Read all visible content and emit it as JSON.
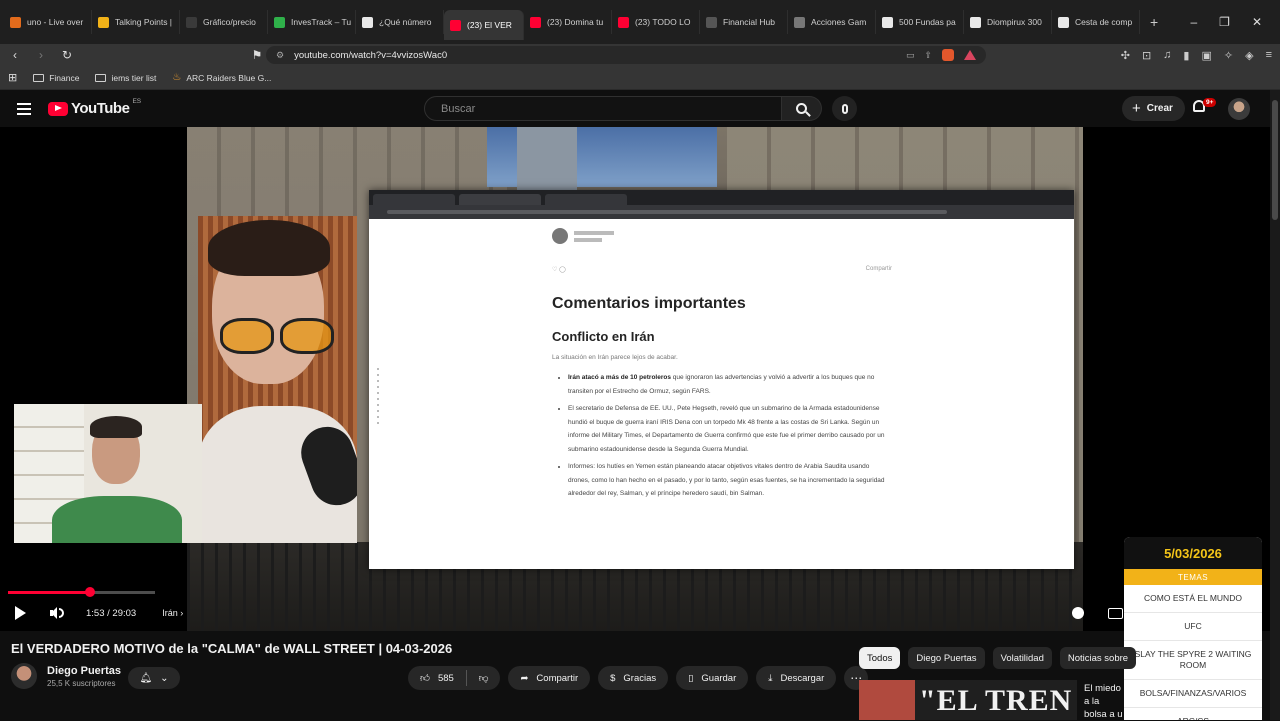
{
  "browser": {
    "tabs": [
      {
        "title": "uno - Live over",
        "color": "#e26b1c",
        "active": false
      },
      {
        "title": "Talking Points |",
        "color": "#f2b218",
        "active": false
      },
      {
        "title": "Gráfico/precio",
        "color": "#3a3a3a",
        "active": false
      },
      {
        "title": "InvesTrack – Tu",
        "color": "#2fb04a",
        "active": false
      },
      {
        "title": "¿Qué número",
        "color": "#e8e8e8",
        "active": false
      },
      {
        "title": "(23) El VER",
        "color": "#ff0033",
        "active": true
      },
      {
        "title": "(23) Domina tu",
        "color": "#ff0033",
        "active": false
      },
      {
        "title": "(23) TODO LO",
        "color": "#ff0033",
        "active": false
      },
      {
        "title": "Financial Hub",
        "color": "#555555",
        "active": false
      },
      {
        "title": "Acciones Gam",
        "color": "#777777",
        "active": false
      },
      {
        "title": "500 Fundas pa",
        "color": "#e8e8e8",
        "active": false
      },
      {
        "title": "Diompirux 300",
        "color": "#e8e8e8",
        "active": false
      },
      {
        "title": "Cesta de comp",
        "color": "#e8e8e8",
        "active": false
      }
    ],
    "new_tab": "+",
    "url": "youtube.com/watch?v=4vvizosWac0",
    "bookmarks": [
      {
        "label": "Finance",
        "icon": "folder-icon"
      },
      {
        "label": "iems tier list",
        "icon": "folder-icon"
      },
      {
        "label": "ARC Raiders Blue G...",
        "icon": "fire-icon"
      }
    ]
  },
  "youtube": {
    "logo_text": "YouTube",
    "logo_country": "ES",
    "search_placeholder": "Buscar",
    "create_label": "Crear",
    "notifications_badge": "9+"
  },
  "player": {
    "doc": {
      "heading": "Comentarios importantes",
      "section": "Conflicto en Irán",
      "intro": "La situación en Irán parece lejos de acabar.",
      "share": "Compartir",
      "bullets": [
        {
          "bold": "Irán atacó a más de 10 petroleros",
          "rest": " que ignoraron las advertencias y volvió a advertir a los buques que no transiten por el Estrecho de Ormuz, según FARS."
        },
        {
          "bold": "",
          "rest": "El secretario de Defensa de EE. UU., Pete Hegseth, reveló que un submarino de la Armada estadounidense hundió el buque de guerra iraní IRIS Dena con un torpedo Mk 48 frente a las costas de Sri Lanka. Según un informe del Military Times, el Departamento de Guerra confirmó que este fue el primer derribo causado por un submarino estadounidense desde la Segunda Guerra Mundial."
        },
        {
          "bold": "",
          "rest": "Informes: los hutíes en Yemen están planeando atacar objetivos vitales dentro de Arabia Saudita usando drones, como lo han hecho en el pasado, y por lo tanto, según esas fuentes, se ha incrementado la seguridad alrededor del rey, Salman, y el príncipe heredero saudí, bin Salman."
        }
      ]
    },
    "progress_fraction": 0.0654,
    "time_current": "1:53",
    "time_separator": " / ",
    "time_total": "29:03",
    "chapter": "Irán"
  },
  "overlay": {
    "date": "5/03/2026",
    "label": "TEMAS",
    "topics": [
      "Como está el mundo",
      "UFC",
      "Slay the Spyre 2 waiting room",
      "Bolsa/Finanzas/Varios",
      "ARC/CS"
    ]
  },
  "video": {
    "title": "El VERDADERO MOTIVO de la \"CALMA\" de WALL STREET | 04-03-2026",
    "channel": "Diego Puertas",
    "subscribers": "25,5 K suscriptores",
    "likes": "585",
    "share": "Compartir",
    "thanks": "Gracias",
    "save": "Guardar",
    "download": "Descargar"
  },
  "sidebar": {
    "chips": [
      {
        "label": "Todos",
        "active": true
      },
      {
        "label": "Diego Puertas",
        "active": false
      },
      {
        "label": "Volatilidad",
        "active": false
      },
      {
        "label": "Noticias sobre",
        "active": false
      }
    ],
    "rec_thumb_text": "\"EL TREN",
    "rec_title": "El miedo a la bolsa a u"
  }
}
